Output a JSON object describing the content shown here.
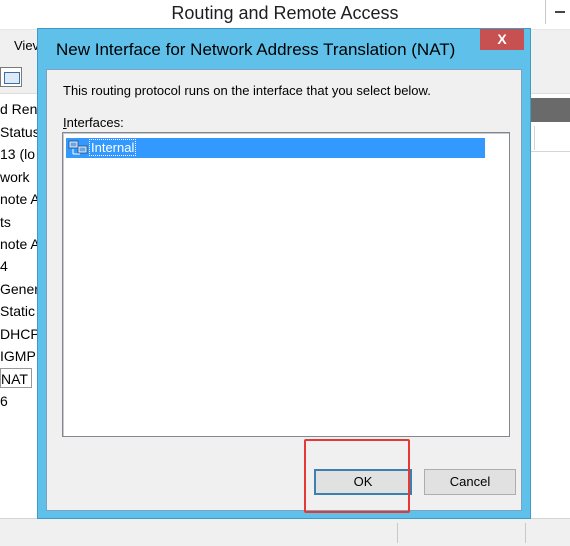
{
  "background_window": {
    "title": "Routing and Remote Access",
    "menu_view_label": "Viev",
    "tree_items": [
      "d Ren",
      "Status",
      "13 (lo",
      "work",
      "note A",
      "ts",
      "note A",
      "4",
      "Gener",
      "Static",
      "DHCP",
      "IGMP",
      "NAT",
      "6"
    ]
  },
  "dialog": {
    "title": "New Interface for Network Address Translation (NAT)",
    "close_glyph": "X",
    "description": "This routing protocol runs on the interface that you select below.",
    "interfaces_label_mnemonic": "I",
    "interfaces_label_rest": "nterfaces:",
    "interfaces": [
      {
        "label": "Internal",
        "selected": true,
        "icon": "network-interface-icon"
      }
    ],
    "ok_label": "OK",
    "cancel_label": "Cancel"
  },
  "annotation": {
    "highlight_color": "#e53935"
  }
}
